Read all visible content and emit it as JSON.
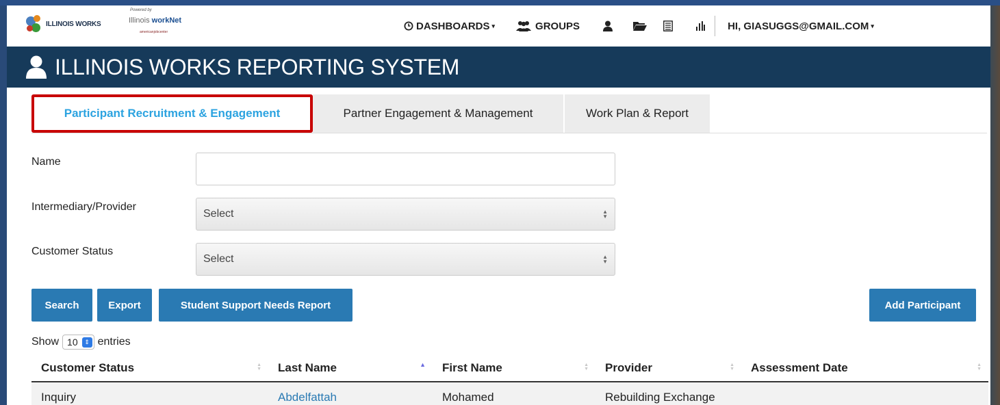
{
  "brand": {
    "logo_text": "ILLINOIS WORKS",
    "powered_by": "Powered by",
    "worknet": "workNet",
    "worknet_prefix": "Illinois",
    "worknet_sub": "CENTER",
    "american_job_center": "americanjobcenter"
  },
  "nav": {
    "dashboards": "DASHBOARDS",
    "groups": "GROUPS",
    "user": "HI, GIASUGGS@GMAIL.COM"
  },
  "banner": {
    "title": "ILLINOIS WORKS REPORTING SYSTEM"
  },
  "tabs": [
    {
      "label": "Participant Recruitment & Engagement",
      "active": true
    },
    {
      "label": "Partner Engagement & Management",
      "active": false
    },
    {
      "label": "Work Plan & Report",
      "active": false
    }
  ],
  "form": {
    "name_label": "Name",
    "name_value": "",
    "provider_label": "Intermediary/Provider",
    "provider_value": "Select",
    "status_label": "Customer Status",
    "status_value": "Select"
  },
  "buttons": {
    "search": "Search",
    "export": "Export",
    "student_support": "Student Support Needs Report",
    "add_participant": "Add Participant"
  },
  "length": {
    "show": "Show",
    "value": "10",
    "entries": "entries"
  },
  "table": {
    "headers": [
      "Customer Status",
      "Last Name",
      "First Name",
      "Provider",
      "Assessment Date"
    ],
    "rows": [
      [
        "Inquiry",
        "Abdelfattah",
        "Mohamed",
        "Rebuilding Exchange",
        ""
      ]
    ]
  },
  "colors": {
    "banner": "#163a5a",
    "button": "#2a7ab3",
    "active_tab": "#2ca3e0",
    "highlight": "#c80000"
  },
  "icons": {
    "dashboards": "clock-icon",
    "groups": "users-icon",
    "user": "user-icon",
    "folder": "folder-icon",
    "list": "list-icon",
    "chart": "bar-chart-icon"
  }
}
